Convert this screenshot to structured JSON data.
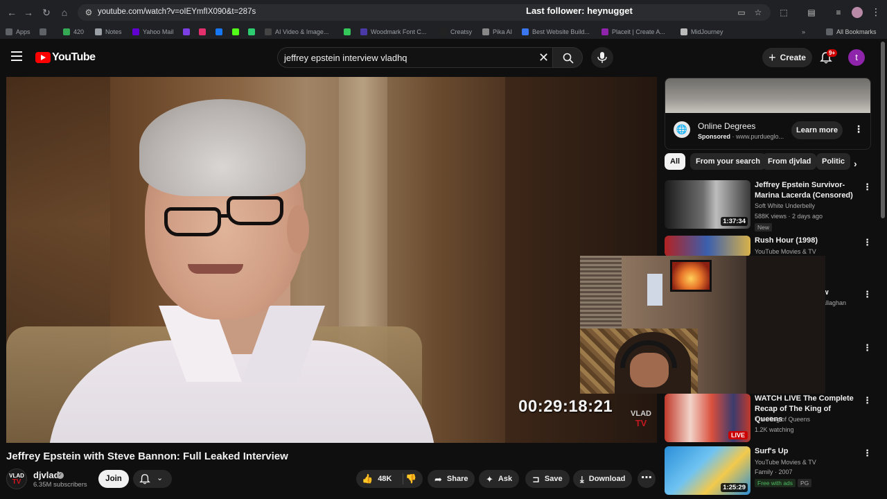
{
  "browser": {
    "url": "youtube.com/watch?v=oIEYmfIX090&t=287s",
    "overlay_text": "Last follower: heynugget",
    "bookmarks": [
      {
        "label": "Apps",
        "color": "#5f6368"
      },
      {
        "label": "",
        "color": "#5f6368"
      },
      {
        "label": "420",
        "color": "#34a853"
      },
      {
        "label": "Notes",
        "color": "#9aa0a6"
      },
      {
        "label": "Yahoo Mail",
        "color": "#6001d2"
      },
      {
        "label": "",
        "color": "#7b3fe4"
      },
      {
        "label": "",
        "color": "#e1306c"
      },
      {
        "label": "",
        "color": "#1877f2"
      },
      {
        "label": "",
        "color": "#53fc18"
      },
      {
        "label": "",
        "color": "#2ecc71"
      },
      {
        "label": "AI Video & Image...",
        "color": "#444444"
      },
      {
        "label": "",
        "color": "#34c759"
      },
      {
        "label": "Woodmark Font C...",
        "color": "#4a3aa8"
      },
      {
        "label": "Creatsy",
        "color": "#222222"
      },
      {
        "label": "Pika AI",
        "color": "#888888"
      },
      {
        "label": "Best Website Build...",
        "color": "#3a76f0"
      },
      {
        "label": "Placeit | Create A...",
        "color": "#8e24aa"
      },
      {
        "label": "MidJourney",
        "color": "#bbbbbb"
      }
    ],
    "all_bookmarks": "All Bookmarks"
  },
  "header": {
    "logo_text": "YouTube",
    "search_query": "jeffrey epstein interview vladhq",
    "create_label": "Create",
    "notifications_badge": "9+",
    "avatar_letter": "t"
  },
  "video": {
    "timecode": "00:29:18:21",
    "watermark_top": "VLAD",
    "watermark_bottom": "TV",
    "title": "Jeffrey Epstein with Steve Bannon: Full Leaked Interview"
  },
  "channel": {
    "avatar_top": "VLAD",
    "avatar_bottom": "TV",
    "name": "djvlad",
    "subscribers": "6.35M subscribers",
    "join_label": "Join"
  },
  "actions": {
    "likes": "48K",
    "share": "Share",
    "ask": "Ask",
    "save": "Save",
    "download": "Download"
  },
  "ad": {
    "title": "Online Degrees",
    "sponsored": "Sponsored",
    "domain": "· www.purdueglo...",
    "cta": "Learn more"
  },
  "chips": [
    "All",
    "From your search",
    "From djvlad",
    "Politic"
  ],
  "recommendations": [
    {
      "title": "Jeffrey Epstein Survivor-Marina Lacerda (Censored)",
      "channel": "Soft White Underbelly",
      "meta": "588K views · 2 days ago",
      "badge": "New",
      "duration": "1:37:34"
    },
    {
      "title": "Rush Hour (1998)",
      "channel": "YouTube Movies & TV",
      "meta": "",
      "badge": "",
      "duration": ""
    },
    {
      "title": "",
      "channel": "allaghan",
      "meta": "",
      "badge": "",
      "duration": ""
    },
    {
      "title": "WATCH LIVE The Complete Recap of The King of Queens",
      "channel": "The King of Queens",
      "meta": "1.2K watching",
      "badge": "",
      "duration": "LIVE"
    },
    {
      "title": "Surf's Up",
      "channel": "YouTube Movies & TV",
      "meta": "Family · 2007",
      "badge": "Free with ads",
      "badge2": "PG",
      "duration": "1:25:29"
    }
  ]
}
